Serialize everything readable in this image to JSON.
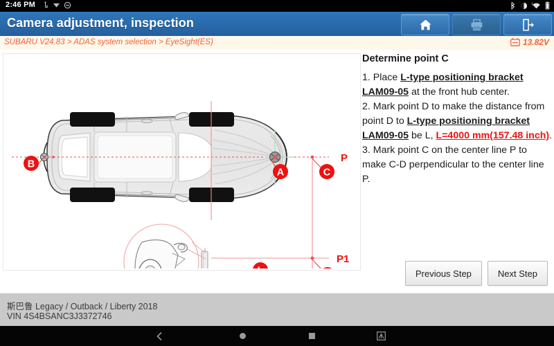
{
  "status_bar": {
    "clock": "2:46 PM",
    "left_icons": [
      "usb-debug-icon",
      "vpn-icon",
      "dnd-icon"
    ],
    "right_icons": [
      "bluetooth-icon",
      "dnd-icon",
      "wifi-icon",
      "battery-icon"
    ]
  },
  "title_bar": {
    "title": "Camera adjustment, inspection",
    "buttons": [
      {
        "name": "home-button",
        "icon": "home-icon"
      },
      {
        "name": "print-button",
        "icon": "printer-icon"
      },
      {
        "name": "exit-button",
        "icon": "exit-icon"
      }
    ]
  },
  "breadcrumb": {
    "text": "SUBARU V24.83 > ADAS system selection > EyeSight(ES)",
    "parts": [
      "SUBARU V24.83",
      "ADAS system selection",
      "EyeSight(ES)"
    ],
    "voltage": "13.82V",
    "voltage_icon": "battery-voltage-icon",
    "accent_color": "#f4603a"
  },
  "instructions": {
    "heading": "Determine point C",
    "step1_num": "1. Place ",
    "step1_bold": "L-type positioning bracket LAM09-05",
    "step1_tail": " at the front hub center.",
    "step2_num": "2. Mark point D to make the distance from point D to ",
    "step2_bold": "L-type positioning bracket LAM09-05",
    "step2_mid": " be L, ",
    "step2_red": "L=4000 mm(157.48 inch)",
    "step2_tail": ".",
    "step3": "3. Mark point C on the center line P to make C-D perpendicular to the center line P.",
    "red_color": "#ee1111"
  },
  "buttons": {
    "previous_step": "Previous Step",
    "next_step": "Next Step"
  },
  "diagram": {
    "name": "vehicle-top-view-alignment-diagram",
    "labels": {
      "A": "A",
      "B": "B",
      "C": "C",
      "D": "D",
      "L": "L",
      "P": "P",
      "P1": "P1"
    },
    "label_color": "#ee1111",
    "vehicle_fill": "#e9e9e9",
    "tire_fill": "#111111",
    "center_line_color": "#f06a6a",
    "detail_circle": "front-hub-bracket-detail"
  },
  "footer": {
    "vehicle": "斯巴鲁 Legacy / Outback / Liberty 2018",
    "vin": "VIN 4S4BSANC3J3372746"
  },
  "nav_bar": {
    "items": [
      {
        "name": "nav-back-button",
        "icon": "chevron-left-icon"
      },
      {
        "name": "nav-home-button",
        "icon": "circle-icon"
      },
      {
        "name": "nav-recents-button",
        "icon": "square-icon"
      },
      {
        "name": "nav-screenshot-button",
        "icon": "screenshot-icon"
      }
    ]
  }
}
